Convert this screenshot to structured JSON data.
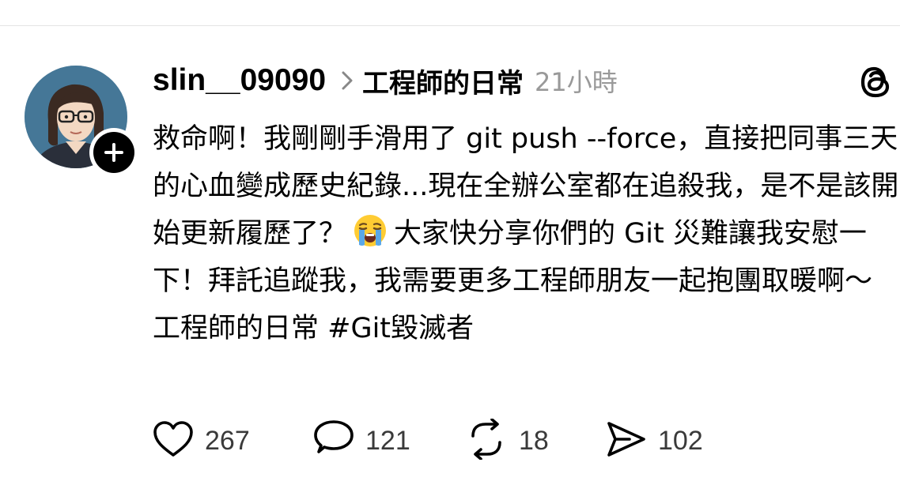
{
  "post": {
    "username": "slin__09090",
    "topic": "工程師的日常",
    "timestamp": "21小時",
    "body_part1": "救命啊！我剛剛手滑用了 git push --force，直接把同事三天的心血變成歷史紀錄...現在全辦公室都在追殺我，是不是該開始更新履歷了？",
    "emoji": "loudly-crying-face",
    "body_part2": "大家快分享你們的 Git 災難讓我安慰一下！拜託追蹤我，我需要更多工程師朋友一起抱團取暖啊～ 工程師的日常 #Git毀滅者"
  },
  "actions": {
    "likes": "267",
    "replies": "121",
    "reposts": "18",
    "shares": "102"
  },
  "icons": {
    "like": "heart-icon",
    "reply": "speech-bubble-icon",
    "repost": "repost-arrows-icon",
    "share": "send-icon",
    "app": "threads-logo-icon",
    "follow": "plus-icon"
  },
  "colors": {
    "text": "#000000",
    "muted": "#999999",
    "counts": "#3a3a3a",
    "divider": "#e4e4e4"
  }
}
